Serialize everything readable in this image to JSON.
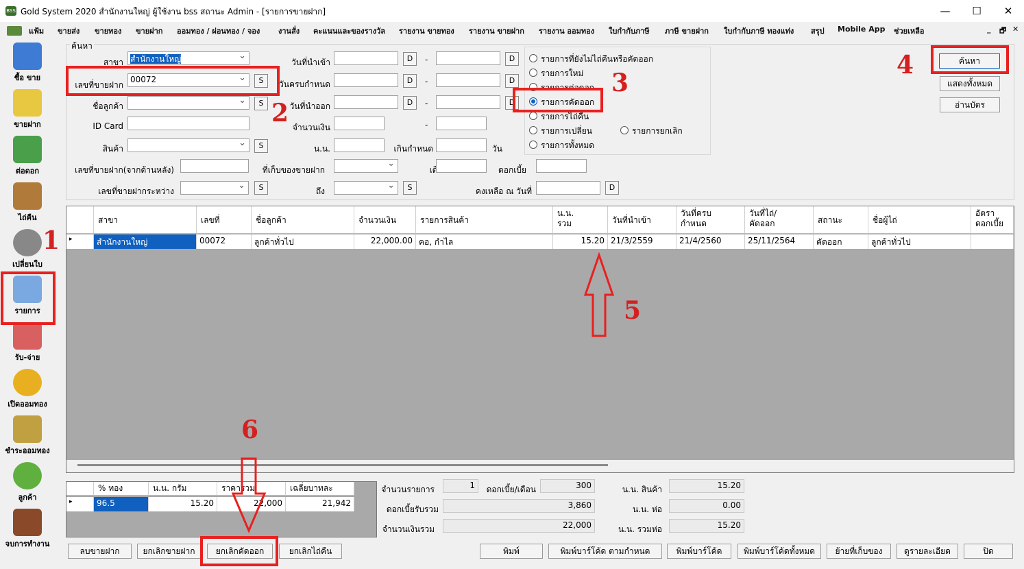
{
  "window": {
    "title": "Gold System 2020  สำนักงานใหญ่ ผู้ใช้งาน bss สถานะ Admin - [รายการขายฝาก]",
    "app_icon": "BSS",
    "minimize": "—",
    "maximize": "☐",
    "close": "✕"
  },
  "menu": [
    "แฟ้ม",
    "ขายส่ง",
    "ขายทอง",
    "ขายฝาก",
    "ออมทอง / ผ่อนทอง / จอง",
    "งานสั่ง",
    "คะแนนและของรางวัล",
    "รายงาน ขายทอง",
    "รายงาน ขายฝาก",
    "รายงาน ออมทอง",
    "ใบกำกับภาษี",
    "ภาษี ขายฝาก",
    "ใบกำกับภาษี ทองแท่ง",
    "สรุป",
    "Mobile App",
    "ช่วยเหลือ"
  ],
  "menu_right": [
    "_",
    "🗗",
    "✕"
  ],
  "sidebar": [
    "ซื้อ ขาย",
    "ขายฝาก",
    "ต่อดอก",
    "ไถ่คืน",
    "เปลี่ยนใบ",
    "รายการ",
    "รับ-จ่าย",
    "เปิดออมทอง",
    "ชำระออมทอง",
    "ลูกค้า",
    "จบการทำงาน"
  ],
  "search": {
    "group_label": "ค้นหา",
    "branch_label": "สาขา",
    "branch_value": "สำนักงานใหญ่",
    "pawn_no_label": "เลขที่ขายฝาก",
    "pawn_no_value": "00072",
    "customer_label": "ชื่อลูกค้า",
    "idcard_label": "ID Card",
    "product_label": "สินค้า",
    "pawn_back_label": "เลขที่ขายฝาก(จากด้านหลัง)",
    "pawn_between_label": "เลขที่ขายฝากระหว่าง",
    "date_in_label": "วันที่นำเข้า",
    "due_label": "วันครบกำหนด",
    "date_out_label": "วันที่นำออก",
    "amount_label": "จำนวนเงิน",
    "weight_label": "น.น.",
    "overdue_label": "เกินกำหนด",
    "day_label": "วัน",
    "storage_label": "ที่เก็บของขายฝาก",
    "month_label": "เดือน",
    "interest_label": "ดอกเบี้ย",
    "to_label": "ถึง",
    "remain_label": "คงเหลือ ณ วันที่",
    "dash": "-",
    "s": "S",
    "d": "D"
  },
  "radios": [
    "รายการที่ยังไม่ไถ่คืนหรือคัดออก",
    "รายการใหม่",
    "รายการต่อดอก",
    "รายการคัดออก",
    "รายการไถ่คืน",
    "รายการเปลี่ยน",
    "รายการยกเลิก",
    "รายการทั้งหมด"
  ],
  "buttons_right": {
    "search": "ค้นหา",
    "show_all": "แสดงทั้งหมด",
    "read_card": "อ่านบัตร"
  },
  "annotations": [
    "1",
    "2",
    "3",
    "4",
    "5",
    "6"
  ],
  "grid": {
    "headers": [
      "สาขา",
      "เลขที่",
      "ชื่อลูกค้า",
      "จำนวนเงิน",
      "รายการสินค้า",
      "น.น.\nรวม",
      "วันที่นำเข้า",
      "วันที่ครบ\nกำหนด",
      "วันที่ไถ่/\nคัดออก",
      "สถานะ",
      "ชื่อผู้ไถ่",
      "อัตรา\nดอกเบี้ย"
    ],
    "row": [
      "สำนักงานใหญ่",
      "00072",
      "ลูกค้าทั่วไป",
      "22,000.00",
      "คอ, กำไล",
      "15.20",
      "21/3/2559",
      "21/4/2560",
      "25/11/2564",
      "คัดออก",
      "ลูกค้าทั่วไป",
      ""
    ],
    "row_marker": "▸"
  },
  "gold": {
    "headers": [
      "% ทอง",
      "น.น. กรัม",
      "ราคารวม",
      "เฉลี่ยบาทละ"
    ],
    "row": [
      "96.5",
      "15.20",
      "22,000",
      "21,942"
    ]
  },
  "summary": {
    "count_label": "จำนวนรายการ",
    "count": "1",
    "int_month_label": "ดอกเบี้ย/เดือน",
    "int_month": "300",
    "int_total_label": "ดอกเบี้ยรับรวม",
    "int_total": "3,860",
    "amount_total_label": "จำนวนเงินรวม",
    "amount_total": "22,000",
    "w_product_label": "น.น. สินค้า",
    "w_product": "15.20",
    "w_pack_label": "น.น. ห่อ",
    "w_pack": "0.00",
    "w_total_label": "น.น. รวมห่อ",
    "w_total": "15.20"
  },
  "bottom_buttons": [
    "ลบขายฝาก",
    "ยกเลิกขายฝาก",
    "ยกเลิกคัดออก",
    "ยกเลิกไถ่คืน",
    "พิมพ์",
    "พิมพ์บาร์โค้ด ตามกำหนด",
    "พิมพ์บาร์โค้ด",
    "พิมพ์บาร์โค้ดทั้งหมด",
    "ย้ายที่เก็บของ",
    "ดูรายละเอียด",
    "ปิด"
  ]
}
